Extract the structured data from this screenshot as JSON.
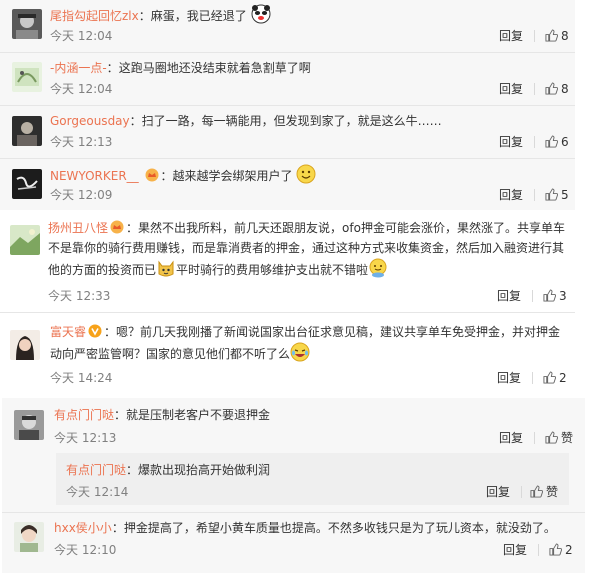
{
  "colon": "：",
  "reply_label": "回复",
  "comments": [
    {
      "user": "尾指勾起回忆zlx",
      "text": "麻蛋，我已经退了",
      "time": "今天 12:04",
      "likes": "8"
    },
    {
      "user": "-内涵一点-",
      "text": "这跑马圈地还没结束就着急割草了啊",
      "time": "今天 12:04",
      "likes": "8"
    },
    {
      "user": "Gorgeousday",
      "text": "扫了一路，每一辆能用，但发现到家了，就是这么牛……",
      "time": "今天 12:13",
      "likes": "6"
    },
    {
      "user": "NEWYORKER__",
      "text": "越来越学会绑架用户了",
      "time": "今天 12:09",
      "likes": "5"
    }
  ],
  "long1": {
    "user": "扬州丑八怪",
    "line1": "果然不出我所料，前几天还跟朋友说，ofo押金可能会涨价，果然涨了。共享单车",
    "line2": "不是靠你的骑行费用赚钱，而是靠消费者的押金，通过这种方式来收集资金，然后加入融资进行其",
    "line3a": "他的方面的投资而已",
    "line3b": "平时骑行的费用够维护支出就不错啦",
    "time": "今天 12:33",
    "likes": "3"
  },
  "long2": {
    "user": "富天睿",
    "line1": "嗯？前几天我刚播了新闻说国家出台征求意见稿，建议共享单车免受押金，并对押金",
    "line2": "动向严密监管啊？国家的意见他们都不听了么",
    "time": "今天 14:24",
    "likes": "2"
  },
  "c7": {
    "user": "有点门门哒",
    "text": "就是压制老客户不要退押金",
    "time": "今天 12:13",
    "likes": "赞"
  },
  "c7_reply": {
    "user": "有点门门哒",
    "text": "爆款出现抬高开始做利润",
    "time": "今天 12:14",
    "likes": "赞"
  },
  "c8": {
    "user": "hxx侯小小",
    "text": "押金提高了，希望小黄车质量也提高。不然多收钱只是为了玩儿资本，就没劲了。",
    "time": "今天 12:10",
    "likes": "2"
  }
}
